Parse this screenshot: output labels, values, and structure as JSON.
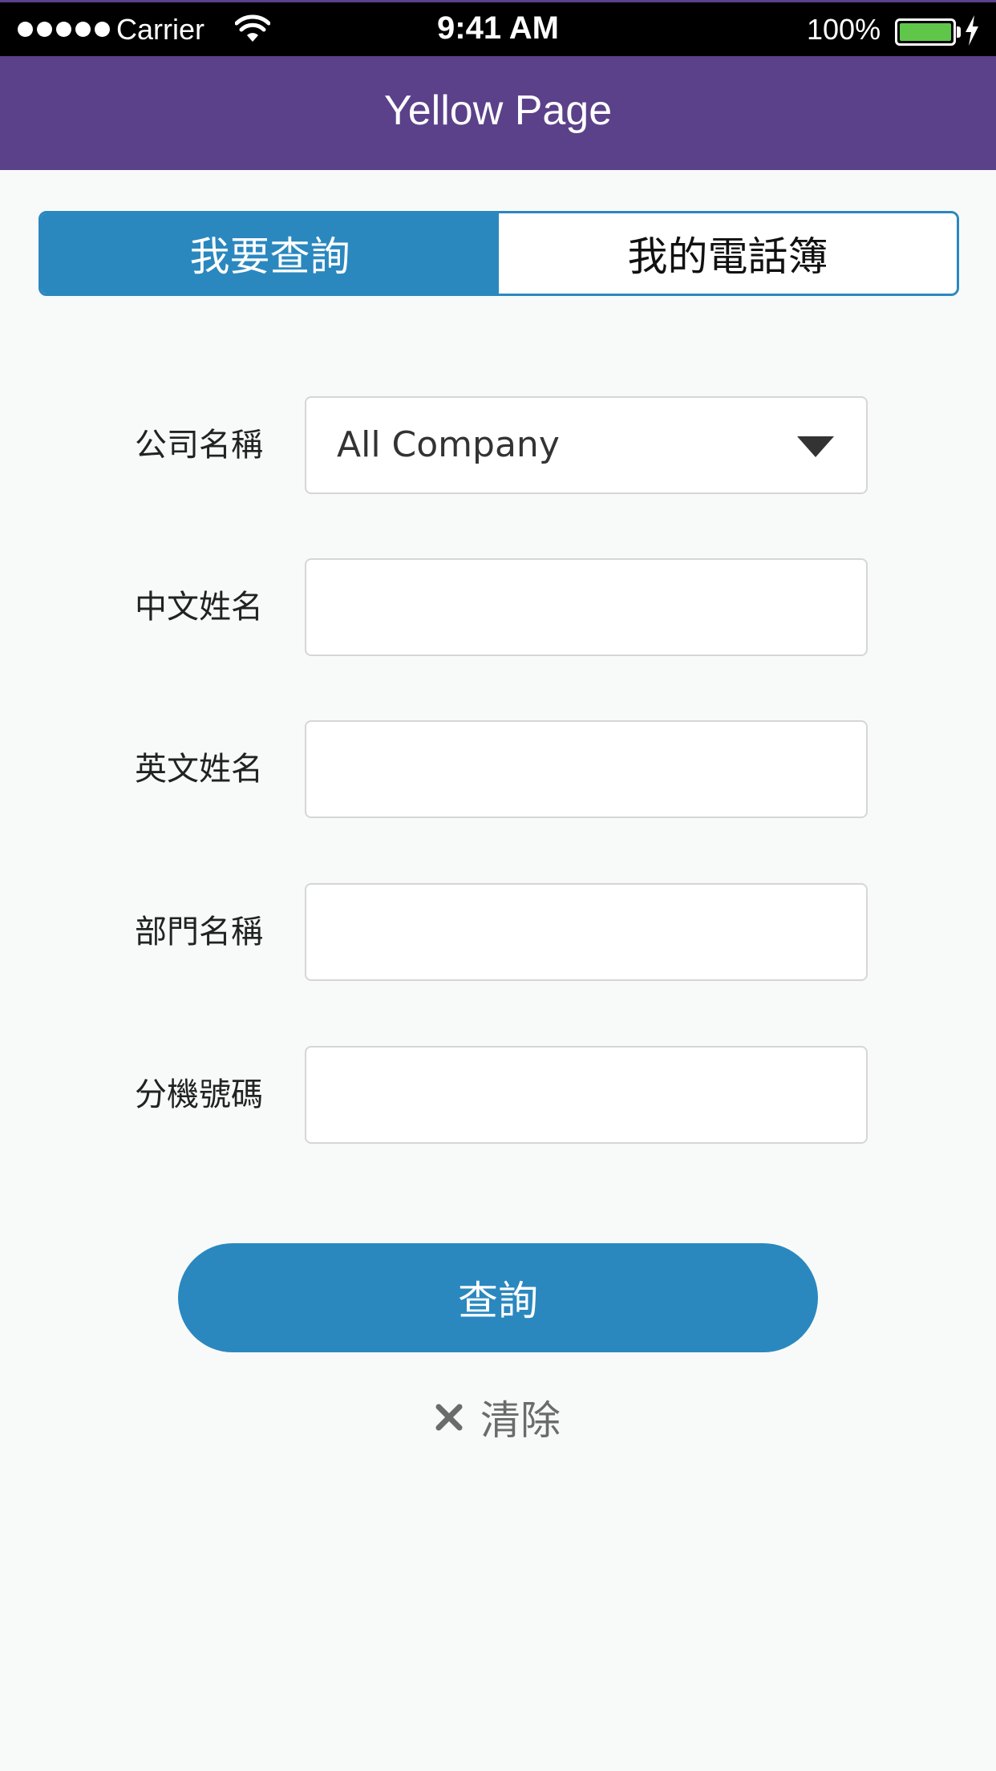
{
  "status_bar": {
    "carrier": "Carrier",
    "time": "9:41 AM",
    "battery_percent": "100%",
    "battery_level": 1.0,
    "signal_bars": 5
  },
  "nav": {
    "title": "Yellow Page",
    "background_color": "#5a4189"
  },
  "tabs": [
    {
      "label": "我要查詢",
      "active": true
    },
    {
      "label": "我的電話簿",
      "active": false
    }
  ],
  "form": {
    "company": {
      "label": "公司名稱",
      "value": "All Company"
    },
    "chinese_name": {
      "label": "中文姓名",
      "value": ""
    },
    "english_name": {
      "label": "英文姓名",
      "value": ""
    },
    "department": {
      "label": "部門名稱",
      "value": ""
    },
    "extension": {
      "label": "分機號碼",
      "value": ""
    }
  },
  "actions": {
    "query_label": "查詢",
    "clear_label": "清除"
  },
  "colors": {
    "accent": "#2a88bf",
    "nav": "#5a4189",
    "background": "#f8fafa"
  },
  "icons": [
    "wifi-icon",
    "battery-icon",
    "bolt-icon",
    "caret-down-icon",
    "close-icon"
  ]
}
